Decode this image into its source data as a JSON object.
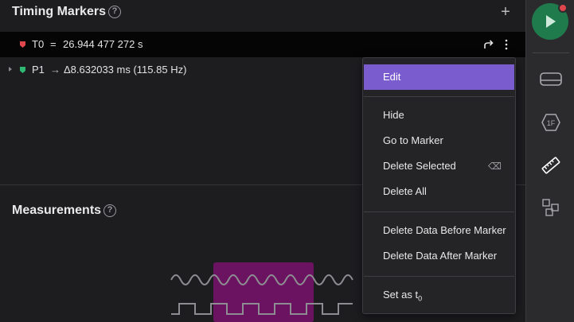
{
  "timing_markers": {
    "title": "Timing Markers",
    "help": "?",
    "add": "+",
    "t0": {
      "name": "T0",
      "eq": "=",
      "value": "26.944 477 272 s",
      "color": "#e0474c"
    },
    "p1": {
      "name": "P1",
      "arrow": "→",
      "value": "Δ8.632033 ms (115.85 Hz)",
      "color": "#2fb872"
    }
  },
  "measurements": {
    "title": "Measurements",
    "help": "?"
  },
  "context_menu": {
    "items": [
      {
        "label": "Edit",
        "active": true
      },
      {
        "label": "Hide"
      },
      {
        "label": "Go to Marker"
      },
      {
        "label": "Delete Selected",
        "shortcut": "⌫"
      },
      {
        "label": "Delete All"
      },
      {
        "label": "Delete Data Before Marker"
      },
      {
        "label": "Delete Data After Marker"
      },
      {
        "label": "Set as t",
        "sub": "0"
      }
    ]
  },
  "sidebar": {
    "run_button": "play-icon",
    "items": [
      "device-icon",
      "analyzer-1f-icon",
      "ruler-icon",
      "extensions-icon"
    ]
  },
  "colors": {
    "accent": "#7b5ccf",
    "run": "#1f7a4c",
    "signal_highlight": "#6b1360"
  }
}
